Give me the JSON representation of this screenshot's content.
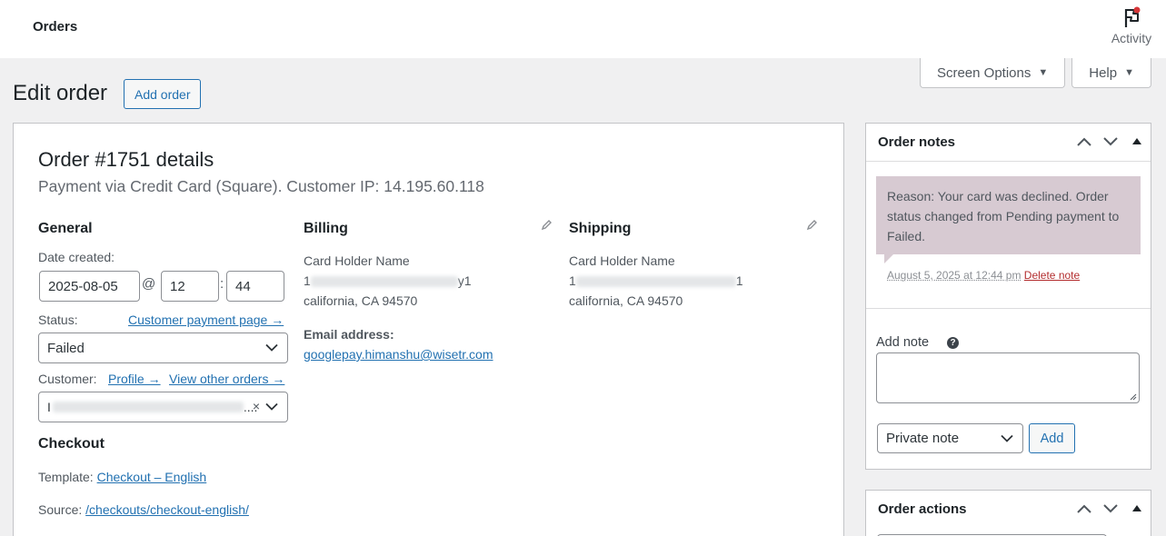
{
  "topbar": {
    "title": "Orders",
    "activity_label": "Activity"
  },
  "screen_options": {
    "label": "Screen Options"
  },
  "help": {
    "label": "Help"
  },
  "page": {
    "title": "Edit order",
    "add_order_label": "Add order"
  },
  "order": {
    "heading": "Order #1751 details",
    "subtitle": "Payment via Credit Card (Square). Customer IP: 14.195.60.118"
  },
  "general": {
    "title": "General",
    "date_label": "Date created:",
    "date_value": "2025-08-05",
    "at_symbol": "@",
    "hour_value": "12",
    "colon": ":",
    "minute_value": "44",
    "status_label": "Status:",
    "customer_payment_link": "Customer payment page →",
    "status_value": "Failed",
    "customer_label": "Customer:",
    "profile_link": "Profile →",
    "view_orders_link": "View other orders →",
    "customer_value_prefix": "I",
    "customer_value_suffix": "...."
  },
  "checkout": {
    "title": "Checkout",
    "template_label": "Template:",
    "template_link": "Checkout – English",
    "source_label": "Source:",
    "source_link": "/checkouts/checkout-english/"
  },
  "billing": {
    "title": "Billing",
    "name": "Card Holder Name",
    "line1_prefix": "1",
    "line1_suffix": "y1",
    "city": "california, CA 94570",
    "email_label": "Email address:",
    "email": "googlepay.himanshu@wisetr.com"
  },
  "shipping": {
    "title": "Shipping",
    "name": "Card Holder Name",
    "line1_prefix": "1",
    "line1_suffix": "1",
    "city": "california, CA 94570"
  },
  "order_notes": {
    "title": "Order notes",
    "note_text": "Reason: Your card was declined. Order status changed from Pending payment to Failed.",
    "note_date": "August 5, 2025 at 12:44 pm",
    "delete_label": "Delete note",
    "add_note_label": "Add note",
    "help_glyph": "?",
    "note_type_value": "Private note",
    "add_button_label": "Add"
  },
  "order_actions": {
    "title": "Order actions"
  },
  "colors": {
    "accent": "#2271b1",
    "note_bg": "#d7cad2",
    "danger": "#b32d2e",
    "notification": "#d63638"
  }
}
